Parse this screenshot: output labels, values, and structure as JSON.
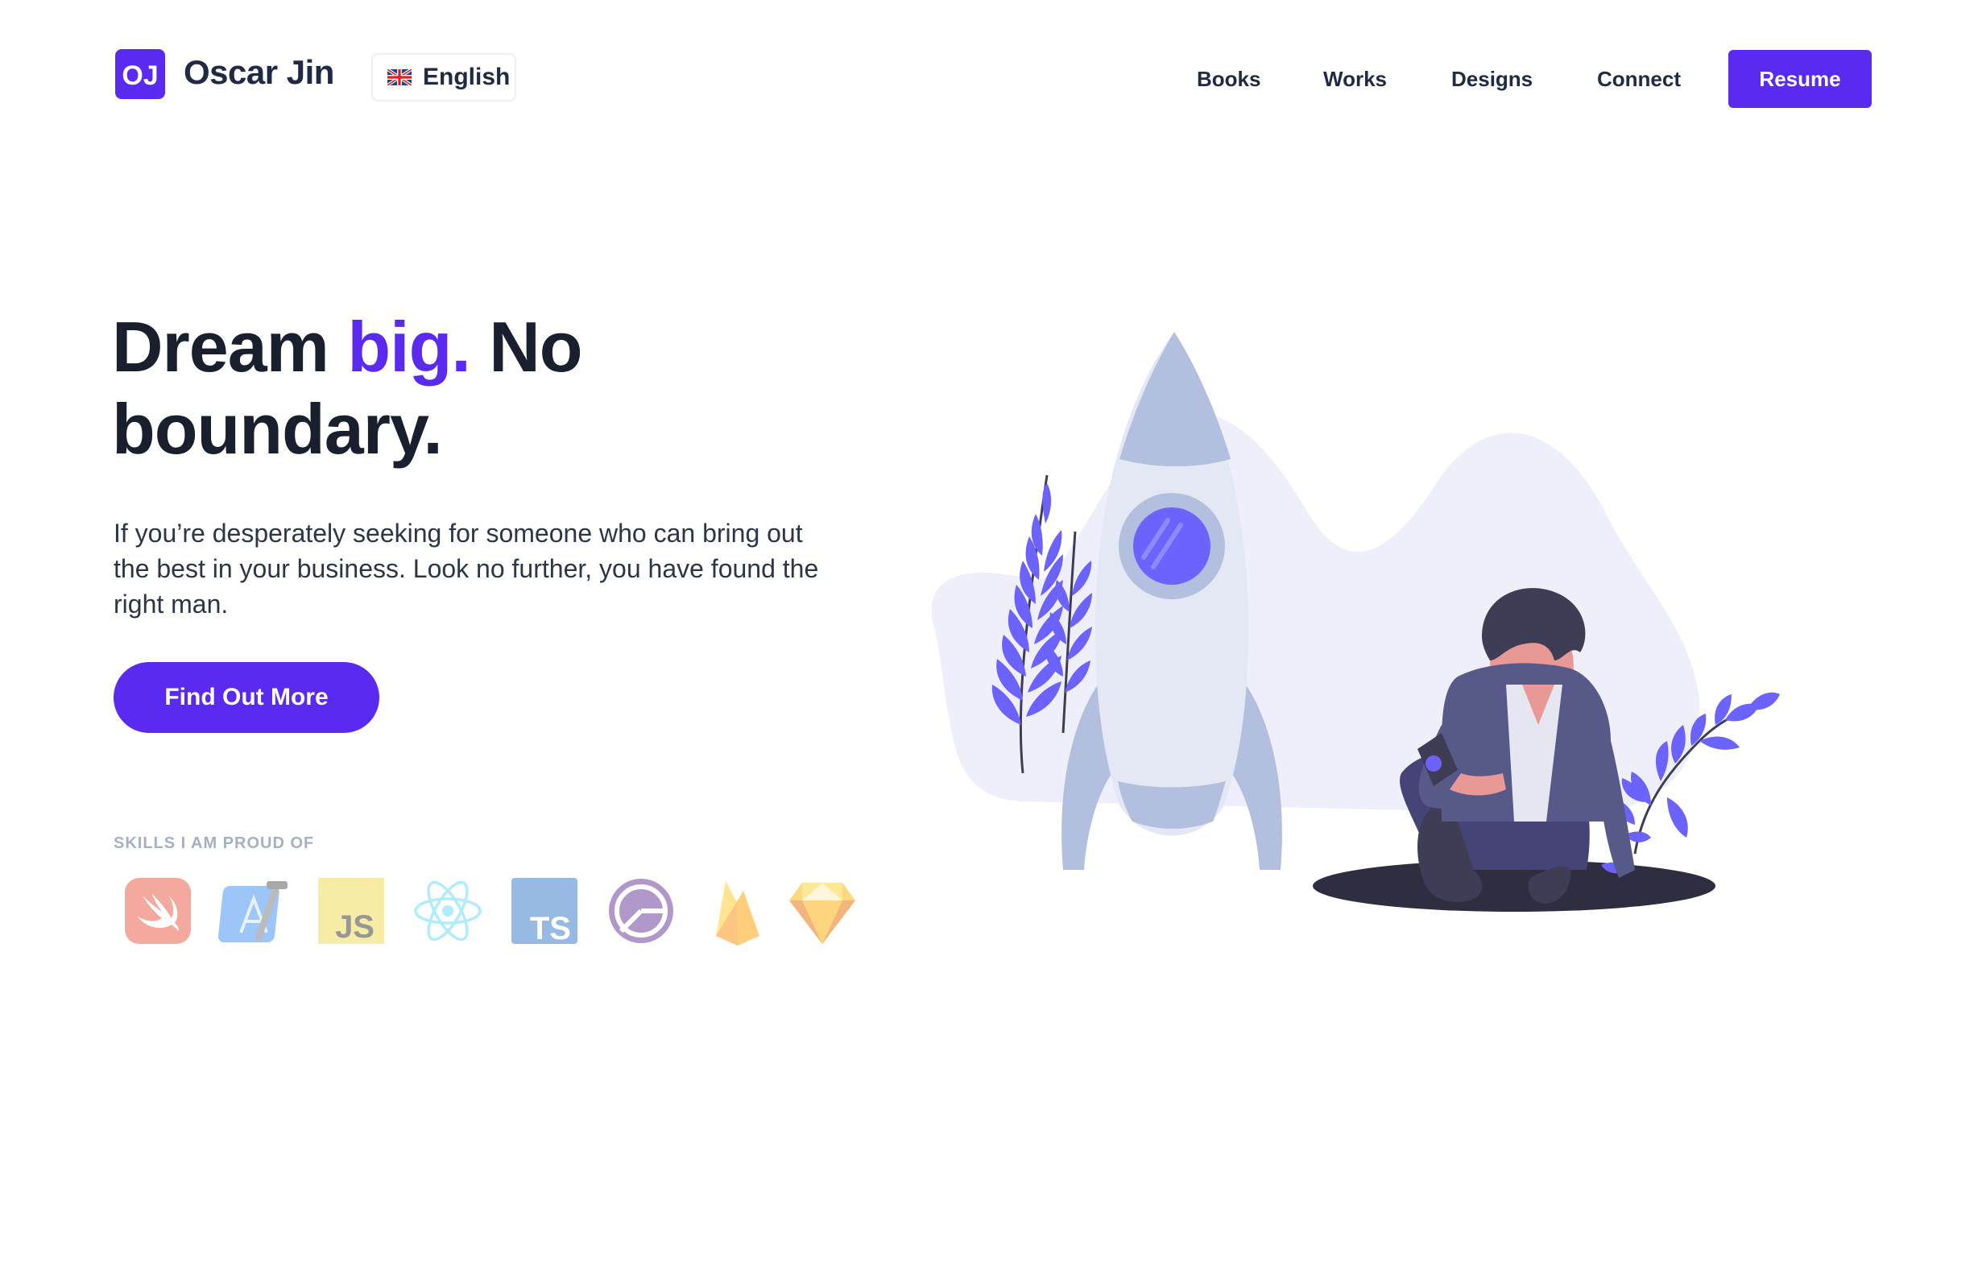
{
  "header": {
    "brand_initials": "OJ",
    "brand_name": "Oscar Jin",
    "language": {
      "label": "English",
      "flag": "uk-flag-icon"
    },
    "nav": [
      {
        "label": "Books"
      },
      {
        "label": "Works"
      },
      {
        "label": "Designs"
      },
      {
        "label": "Connect"
      }
    ],
    "resume_label": "Resume"
  },
  "hero": {
    "headline_part1": "Dream ",
    "headline_accent": "big.",
    "headline_part2": " No boundary.",
    "intro": "If you’re desperately seeking for someone who can bring out the best in your business. Look no further, you have found the right man.",
    "cta_label": "Find Out More"
  },
  "skills": {
    "label": "SKILLS I AM PROUD OF",
    "icons": [
      {
        "name": "swift-icon"
      },
      {
        "name": "xcode-icon"
      },
      {
        "name": "javascript-icon",
        "text": "JS"
      },
      {
        "name": "react-icon"
      },
      {
        "name": "typescript-icon",
        "text": "TS"
      },
      {
        "name": "gatsby-icon"
      },
      {
        "name": "firebase-icon"
      },
      {
        "name": "sketch-icon"
      }
    ]
  },
  "colors": {
    "accent": "#5b2af0",
    "text_dark": "#1a1f2e",
    "nav_text": "#1f2a44",
    "muted": "#a6b0c4"
  }
}
